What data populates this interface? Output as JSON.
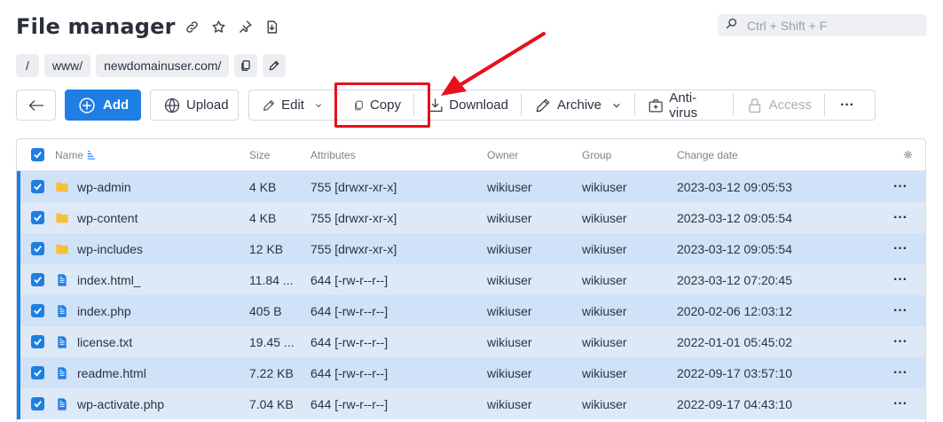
{
  "header": {
    "title": "File manager",
    "search_placeholder": "Ctrl + Shift + F"
  },
  "breadcrumbs": [
    "/",
    "www/",
    "newdomainuser.com/"
  ],
  "toolbar": {
    "add": "Add",
    "upload": "Upload",
    "edit": "Edit",
    "copy": "Copy",
    "download": "Download",
    "archive": "Archive",
    "antivirus": "Anti-virus",
    "access": "Access",
    "more": "···"
  },
  "table": {
    "columns": {
      "name": "Name",
      "size": "Size",
      "attributes": "Attributes",
      "owner": "Owner",
      "group": "Group",
      "date": "Change date"
    },
    "rows": [
      {
        "type": "folder",
        "name": "wp-admin",
        "size": "4 KB",
        "attributes": "755 [drwxr-xr-x]",
        "owner": "wikiuser",
        "group": "wikiuser",
        "date": "2023-03-12 09:05:53"
      },
      {
        "type": "folder",
        "name": "wp-content",
        "size": "4 KB",
        "attributes": "755 [drwxr-xr-x]",
        "owner": "wikiuser",
        "group": "wikiuser",
        "date": "2023-03-12 09:05:54"
      },
      {
        "type": "folder",
        "name": "wp-includes",
        "size": "12 KB",
        "attributes": "755 [drwxr-xr-x]",
        "owner": "wikiuser",
        "group": "wikiuser",
        "date": "2023-03-12 09:05:54"
      },
      {
        "type": "file",
        "name": "index.html_",
        "size": "11.84 ...",
        "attributes": "644 [-rw-r--r--]",
        "owner": "wikiuser",
        "group": "wikiuser",
        "date": "2023-03-12 07:20:45"
      },
      {
        "type": "file",
        "name": "index.php",
        "size": "405 B",
        "attributes": "644 [-rw-r--r--]",
        "owner": "wikiuser",
        "group": "wikiuser",
        "date": "2020-02-06 12:03:12"
      },
      {
        "type": "file",
        "name": "license.txt",
        "size": "19.45 ...",
        "attributes": "644 [-rw-r--r--]",
        "owner": "wikiuser",
        "group": "wikiuser",
        "date": "2022-01-01 05:45:02"
      },
      {
        "type": "file",
        "name": "readme.html",
        "size": "7.22 KB",
        "attributes": "644 [-rw-r--r--]",
        "owner": "wikiuser",
        "group": "wikiuser",
        "date": "2022-09-17 03:57:10"
      },
      {
        "type": "file",
        "name": "wp-activate.php",
        "size": "7.04 KB",
        "attributes": "644 [-rw-r--r--]",
        "owner": "wikiuser",
        "group": "wikiuser",
        "date": "2022-09-17 04:43:10"
      }
    ],
    "row_menu": "···"
  },
  "colors": {
    "accent": "#1f7ee3",
    "highlight": "#e8101b",
    "row_selected_a": "#cfe2f7",
    "row_selected_b": "#dde9f7",
    "folder": "#f7bf3c"
  }
}
